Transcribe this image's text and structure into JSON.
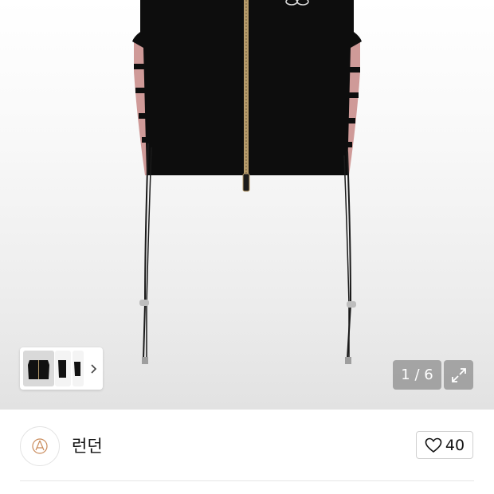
{
  "gallery": {
    "counter": "1 / 6",
    "next_icon": "chevron-right-icon",
    "expand_icon": "expand-icon"
  },
  "seller": {
    "name": "런던",
    "avatar_icon": "store-logo-icon"
  },
  "likes": {
    "count": "40",
    "icon": "heart-outline-icon"
  },
  "colors": {
    "vest_black": "#0d0d0d",
    "side_panel_pink": "#cf9a98",
    "zipper_gold": "#b59a6a",
    "overlay_grey": "#8c8c8c"
  }
}
